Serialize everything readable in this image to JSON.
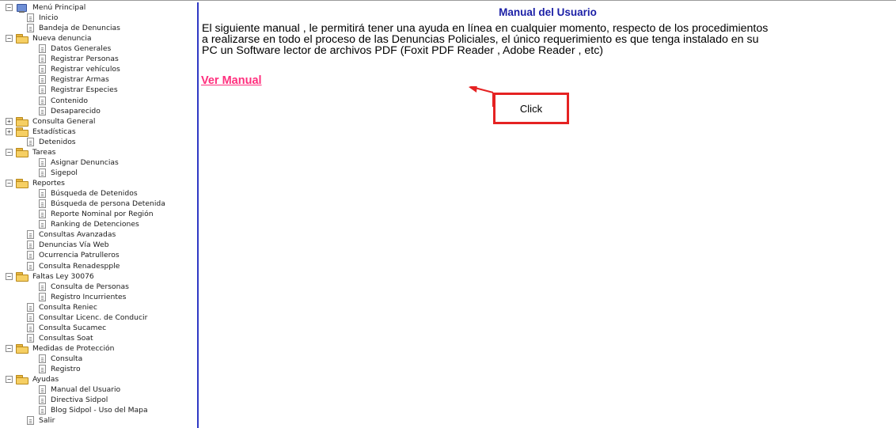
{
  "sidebar": {
    "items": [
      {
        "label": "Menú Principal",
        "kind": "root",
        "expander": "−",
        "level": 0
      },
      {
        "label": "Inicio",
        "kind": "page",
        "level": 1
      },
      {
        "label": "Bandeja de Denuncias",
        "kind": "page",
        "level": 1
      },
      {
        "label": "Nueva denuncia",
        "kind": "folder",
        "expander": "−",
        "level": 0
      },
      {
        "label": "Datos Generales",
        "kind": "page",
        "level": 2
      },
      {
        "label": "Registrar Personas",
        "kind": "page",
        "level": 2
      },
      {
        "label": "Registrar vehículos",
        "kind": "page",
        "level": 2
      },
      {
        "label": "Registrar Armas",
        "kind": "page",
        "level": 2
      },
      {
        "label": "Registrar Especies",
        "kind": "page",
        "level": 2
      },
      {
        "label": "Contenido",
        "kind": "page",
        "level": 2
      },
      {
        "label": "Desaparecido",
        "kind": "page",
        "level": 2
      },
      {
        "label": "Consulta General",
        "kind": "folder",
        "expander": "+",
        "level": 0
      },
      {
        "label": "Estadísticas",
        "kind": "folder",
        "expander": "+",
        "level": 0
      },
      {
        "label": "Detenidos",
        "kind": "page",
        "level": 1
      },
      {
        "label": "Tareas",
        "kind": "folder",
        "expander": "−",
        "level": 0
      },
      {
        "label": "Asignar Denuncias",
        "kind": "page",
        "level": 2
      },
      {
        "label": "Sigepol",
        "kind": "page",
        "level": 2
      },
      {
        "label": "Reportes",
        "kind": "folder",
        "expander": "−",
        "level": 0
      },
      {
        "label": "Búsqueda de Detenidos",
        "kind": "page",
        "level": 2
      },
      {
        "label": "Búsqueda de persona Detenida",
        "kind": "page",
        "level": 2
      },
      {
        "label": "Reporte Nominal por Región",
        "kind": "page",
        "level": 2
      },
      {
        "label": "Ranking de Detenciones",
        "kind": "page",
        "level": 2
      },
      {
        "label": "Consultas Avanzadas",
        "kind": "page",
        "level": 1
      },
      {
        "label": "Denuncias Vía Web",
        "kind": "page",
        "level": 1
      },
      {
        "label": "Ocurrencia Patrulleros",
        "kind": "page",
        "level": 1
      },
      {
        "label": "Consulta Renadespple",
        "kind": "page",
        "level": 1
      },
      {
        "label": "Faltas Ley 30076",
        "kind": "folder",
        "expander": "−",
        "level": 0
      },
      {
        "label": "Consulta de Personas",
        "kind": "page",
        "level": 2
      },
      {
        "label": "Registro Incurrientes",
        "kind": "page",
        "level": 2
      },
      {
        "label": "Consulta Reniec",
        "kind": "page",
        "level": 1
      },
      {
        "label": "Consultar Licenc. de Conducir",
        "kind": "page",
        "level": 1
      },
      {
        "label": "Consulta Sucamec",
        "kind": "page",
        "level": 1
      },
      {
        "label": "Consultas Soat",
        "kind": "page",
        "level": 1
      },
      {
        "label": "Medidas de Protección",
        "kind": "folder",
        "expander": "−",
        "level": 0
      },
      {
        "label": "Consulta",
        "kind": "page",
        "level": 2
      },
      {
        "label": "Registro",
        "kind": "page",
        "level": 2
      },
      {
        "label": "Ayudas",
        "kind": "folder",
        "expander": "−",
        "level": 0
      },
      {
        "label": "Manual del Usuario",
        "kind": "page",
        "level": 2
      },
      {
        "label": "Directiva Sidpol",
        "kind": "page",
        "level": 2
      },
      {
        "label": "Blog Sidpol - Uso del Mapa",
        "kind": "page",
        "level": 2
      },
      {
        "label": "Salir",
        "kind": "page",
        "level": 1
      }
    ]
  },
  "main": {
    "title": "Manual del Usuario",
    "intro_lines": [
      "El siguiente manual , le permitirá tener una ayuda en línea en cualquier momento, respecto de los procedimientos",
      "a realizarse en todo el proceso de las Denuncias Policiales, el único requerimiento es que tenga instalado en su",
      "PC un Software lector de archivos PDF (Foxit PDF Reader , Adobe Reader , etc)"
    ],
    "link_label": "Ver Manual",
    "callout_label": "Click"
  },
  "colors": {
    "title": "#1b1fa6",
    "link": "#ff2f7d",
    "sidebar_border": "#2f39c4",
    "callout": "#e52222"
  }
}
